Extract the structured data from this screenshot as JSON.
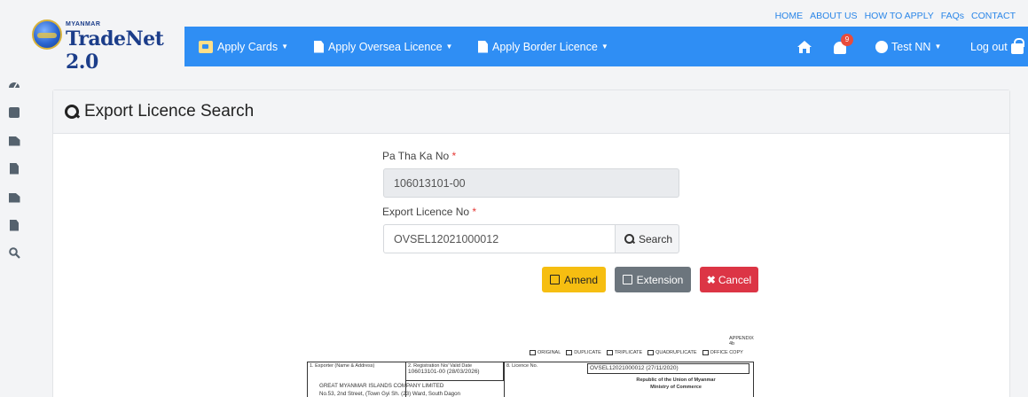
{
  "logo": {
    "small": "MYANMAR",
    "main": "TradeNet 2.0"
  },
  "top_links": [
    "HOME",
    "ABOUT US",
    "HOW TO APPLY",
    "FAQs",
    "CONTACT"
  ],
  "nav": {
    "apply_cards": "Apply Cards",
    "apply_oversea": "Apply Oversea Licence",
    "apply_border": "Apply Border Licence",
    "notification_count": "9",
    "user": "Test NN",
    "logout": "Log out"
  },
  "sidebar_icons": [
    "dashboard-icon",
    "id-card-icon",
    "edit-doc-icon",
    "file-code-icon",
    "edit-doc-icon-2",
    "file-code-icon-2",
    "search-icon"
  ],
  "colors": {
    "nav": "#2f8ef4",
    "amend": "#f6be11",
    "extension": "#6c757d",
    "cancel": "#dc3545",
    "required": "#e53935"
  },
  "page": {
    "title": "Export Licence Search",
    "patha_label": "Pa Tha Ka No",
    "patha_value": "106013101-00",
    "licence_label": "Export Licence No",
    "licence_value": "OVSEL12021000012",
    "required_mark": "*",
    "search_label": "Search",
    "amend_label": "Amend",
    "extension_label": "Extension",
    "cancel_label": "Cancel"
  },
  "document": {
    "appendix": "APPENDIX 4b",
    "copies": [
      "ORIGINAL",
      "DUPLICATE",
      "TRIPLICATE",
      "QUADRUPLICATE",
      "OFFICE COPY"
    ],
    "exporter_label": "1. Exporter (Name & Address)",
    "registration_label": "2. Registration No/ Valid Date",
    "registration_value": "106013101-00 (28/03/2026)",
    "licence_no_label": "8. Licence No.",
    "licence_no_value": "OVSEL12021000012 (27/11/2020)",
    "company": "GREAT MYANMAR ISLANDS COMPANY LIMITED",
    "address": "No.53, 2nd Street, (Town Gyi Sh. (23) Ward, South Dagon",
    "republic": "Republic of the Union of Myanmar",
    "ministry": "Ministry of Commerce"
  }
}
